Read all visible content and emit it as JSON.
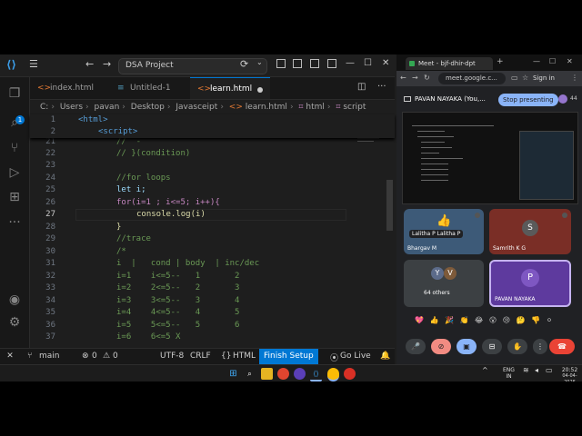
{
  "vscode": {
    "title_search": "DSA Project",
    "tabs": [
      {
        "label": "index.html",
        "icon": "html-file-icon",
        "active": false
      },
      {
        "label": "Untitled-1",
        "icon": "file-icon",
        "active": false
      },
      {
        "label": "learn.html",
        "icon": "html-file-icon",
        "active": true,
        "modified": true
      }
    ],
    "breadcrumb": [
      "C:",
      "Users",
      "pavan",
      "Desktop",
      "Javasceipt",
      "learn.html",
      "html",
      "script"
    ],
    "activity_badge": "1",
    "sticky": [
      {
        "n": "1",
        "text": "<html>"
      },
      {
        "n": "2",
        "text": "<script>"
      }
    ],
    "lines": [
      {
        "n": "21",
        "text": "//  -"
      },
      {
        "n": "22",
        "text": "// }(condition)"
      },
      {
        "n": "23",
        "text": ""
      },
      {
        "n": "24",
        "text": "//for loops"
      },
      {
        "n": "25",
        "text": "let i;"
      },
      {
        "n": "26",
        "text": "for(i=1 ; i<=5; i++){"
      },
      {
        "n": "27",
        "text": "console.log(i)"
      },
      {
        "n": "28",
        "text": "}"
      },
      {
        "n": "29",
        "text": "//trace"
      },
      {
        "n": "30",
        "text": "/*"
      },
      {
        "n": "31",
        "text": "i  |   cond | body  | inc/dec"
      },
      {
        "n": "32",
        "text": "i=1    i<=5--   1       2"
      },
      {
        "n": "33",
        "text": "i=2    2<=5--   2       3"
      },
      {
        "n": "34",
        "text": "i=3    3<=5--   3       4"
      },
      {
        "n": "35",
        "text": "i=4    4<=5--   4       5"
      },
      {
        "n": "36",
        "text": "i=5    5<=5--   5       6"
      },
      {
        "n": "37",
        "text": "i=6    6<=5 X"
      }
    ],
    "status": {
      "branch": "main",
      "errors": "0",
      "warnings": "0",
      "encoding": "UTF-8",
      "eol": "CRLF",
      "language": "HTML",
      "finish_setup": "Finish Setup",
      "go_live": "Go Live"
    }
  },
  "browser": {
    "tab_label": "Meet - bjf-dhir-dpt",
    "url": "meet.google.c...",
    "signin": "Sign in",
    "presenter": "PAVAN NAYAKA (You,...",
    "stop_presenting": "Stop presenting",
    "tiles": [
      {
        "name": "Bhargav M",
        "color": "#3d5a78"
      },
      {
        "name": "Samrith K G",
        "color": "#7a2e26",
        "initial": "S"
      },
      {
        "name": "64 others",
        "initials": [
          "Y",
          "V"
        ]
      },
      {
        "name": "PAVAN NAYAKA",
        "initial": "P"
      }
    ],
    "tile_caption": "Lalitha P  Lalitha P",
    "reactions": "💖 👍 🎉 👏 😂 😮 😢 🤔 👎 ⚪"
  },
  "taskbar": {
    "lang_top": "ENG",
    "lang_bottom": "IN",
    "time": "20:52",
    "date": "04-04-2026"
  },
  "colors": {
    "accent": "#0078d4",
    "keyword": "#569cd6",
    "comment": "#6a9955",
    "function": "#dcdcaa",
    "stop_button": "#8ab4f8",
    "end_call": "#ea4335"
  }
}
